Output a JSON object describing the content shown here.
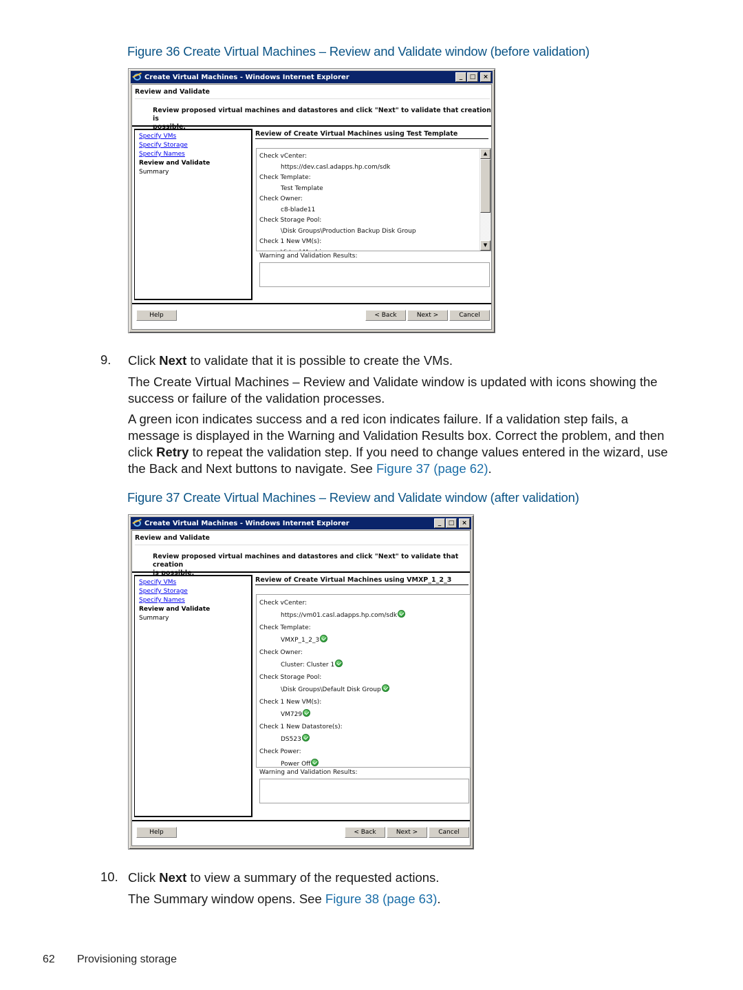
{
  "figure36": {
    "caption": "Figure 36 Create Virtual Machines – Review and Validate window (before validation)",
    "window": {
      "title": "Create Virtual Machines - Windows Internet Explorer",
      "controls": {
        "minimize": "_",
        "maximize": "□",
        "close": "×"
      },
      "page_heading": "Review and Validate",
      "intro_line1": "Review proposed virtual machines and datastores and click \"Next\" to validate that creation is",
      "intro_line2": "possible.",
      "nav": [
        "Specify VMs",
        "Specify Storage",
        "Specify Names",
        "Review and Validate",
        "Summary"
      ],
      "review_title": "Review of Create Virtual Machines using Test Template",
      "checks": [
        {
          "label": "Check vCenter:",
          "value": "https://dev.casl.adapps.hp.com/sdk"
        },
        {
          "label": "Check Template:",
          "value": "Test Template"
        },
        {
          "label": "Check Owner:",
          "value": "c8-blade11"
        },
        {
          "label": "Check Storage Pool:",
          "value": "\\Disk Groups\\Production Backup Disk Group"
        },
        {
          "label": "Check 1 New VM(s):",
          "value": "Virtual Machine"
        }
      ],
      "warning_label": "Warning and Validation Results:",
      "warning_text": "",
      "buttons": {
        "help": "Help",
        "back": "< Back",
        "next": "Next >",
        "cancel": "Cancel"
      }
    }
  },
  "step9": {
    "number": "9.",
    "line_pre": "Click ",
    "line_bold": "Next",
    "line_post": " to validate that it is possible to create the VMs.",
    "para1": "The Create Virtual Machines – Review and Validate window is updated with icons showing the success or failure of the validation processes.",
    "para2_a": "A green icon indicates success and a red icon indicates failure. If a validation step fails, a message is displayed in the Warning and Validation Results box. Correct the problem, and then click ",
    "para2_bold": "Retry",
    "para2_b": " to repeat the validation step. If you need to change values entered in the wizard, use the Back and Next buttons to navigate. See ",
    "para2_link": "Figure 37 (page 62)",
    "para2_end": "."
  },
  "figure37": {
    "caption": "Figure 37 Create Virtual Machines – Review and Validate window (after validation)",
    "window": {
      "title": "Create Virtual Machines - Windows Internet Explorer",
      "controls": {
        "minimize": "_",
        "maximize": "□",
        "close": "×"
      },
      "page_heading": "Review and Validate",
      "intro_line1": "Review proposed virtual machines and datastores and click \"Next\" to validate that creation",
      "intro_line2": "is possible.",
      "nav": [
        "Specify VMs",
        "Specify Storage",
        "Specify Names",
        "Review and Validate",
        "Summary"
      ],
      "review_title": "Review of Create Virtual Machines using VMXP_1_2_3",
      "checks": [
        {
          "label": "Check vCenter:",
          "value": "https://vm01.casl.adapps.hp.com/sdk",
          "status": "success"
        },
        {
          "label": "Check Template:",
          "value": "VMXP_1_2_3",
          "status": "success"
        },
        {
          "label": "Check Owner:",
          "value": "Cluster: Cluster 1",
          "status": "success"
        },
        {
          "label": "Check Storage Pool:",
          "value": "\\Disk Groups\\Default Disk Group",
          "status": "success"
        },
        {
          "label": "Check 1 New VM(s):",
          "value": "VM729",
          "status": "success"
        },
        {
          "label": "Check 1 New Datastore(s):",
          "value": "DS523",
          "status": "success"
        },
        {
          "label": "Check Power:",
          "value": "Power Off",
          "status": "success"
        }
      ],
      "warning_label": "Warning and Validation Results:",
      "warning_text": "",
      "buttons": {
        "help": "Help",
        "back": "< Back",
        "next": "Next >",
        "cancel": "Cancel"
      }
    }
  },
  "step10": {
    "number": "10.",
    "line_pre": "Click ",
    "line_bold": "Next",
    "line_post": " to view a summary of the requested actions.",
    "para_pre": "The Summary window opens. See ",
    "para_link": "Figure 38 (page 63)",
    "para_end": "."
  },
  "footer": {
    "page_number": "62",
    "section": "Provisioning storage"
  },
  "colors": {
    "caption": "#0b5486",
    "link": "#1b6ea8",
    "titlebar": "#0a246a",
    "success": "#2e9e3a"
  }
}
